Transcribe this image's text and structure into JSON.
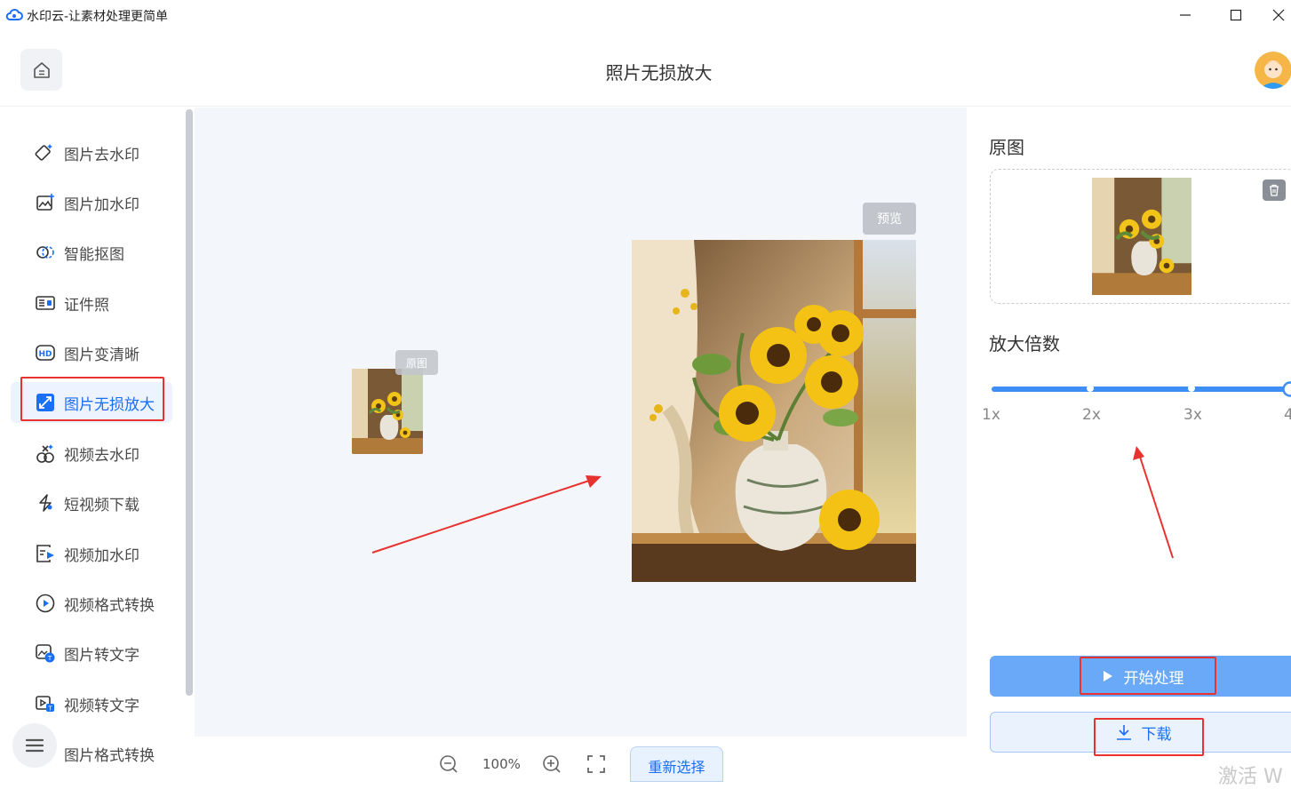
{
  "window": {
    "title": "水印云-让素材处理更简单"
  },
  "header": {
    "title": "照片无损放大"
  },
  "sidebar": {
    "items": [
      {
        "label": "图片去水印",
        "icon": "eraser-icon"
      },
      {
        "label": "图片加水印",
        "icon": "image-add-icon"
      },
      {
        "label": "智能抠图",
        "icon": "cutout-icon"
      },
      {
        "label": "证件照",
        "icon": "id-card-icon"
      },
      {
        "label": "图片变清晰",
        "icon": "hd-icon"
      },
      {
        "label": "图片无损放大",
        "icon": "enlarge-icon",
        "active": true
      },
      {
        "label": "视频去水印",
        "icon": "video-eraser-icon"
      },
      {
        "label": "短视频下载",
        "icon": "link-download-icon"
      },
      {
        "label": "视频加水印",
        "icon": "video-add-icon"
      },
      {
        "label": "视频格式转换",
        "icon": "play-circle-icon"
      },
      {
        "label": "图片转文字",
        "icon": "image-text-icon"
      },
      {
        "label": "视频转文字",
        "icon": "video-text-icon"
      },
      {
        "label": "图片格式转换",
        "icon": "format-icon"
      }
    ]
  },
  "canvas": {
    "original_tag": "原图",
    "preview_tag": "预览"
  },
  "toolbar": {
    "zoom": "100%",
    "reselect_label": "重新选择"
  },
  "right_panel": {
    "original_label": "原图",
    "scale_label": "放大倍数",
    "scale_ticks": [
      "1x",
      "2x",
      "3x",
      "4"
    ],
    "selected_scale": "4x",
    "start_label": "开始处理",
    "download_label": "下载",
    "watermark_text": "激活 W"
  },
  "colors": {
    "accent": "#1a6ff5",
    "highlight": "#e8322f",
    "slider": "#3d8ef5"
  }
}
